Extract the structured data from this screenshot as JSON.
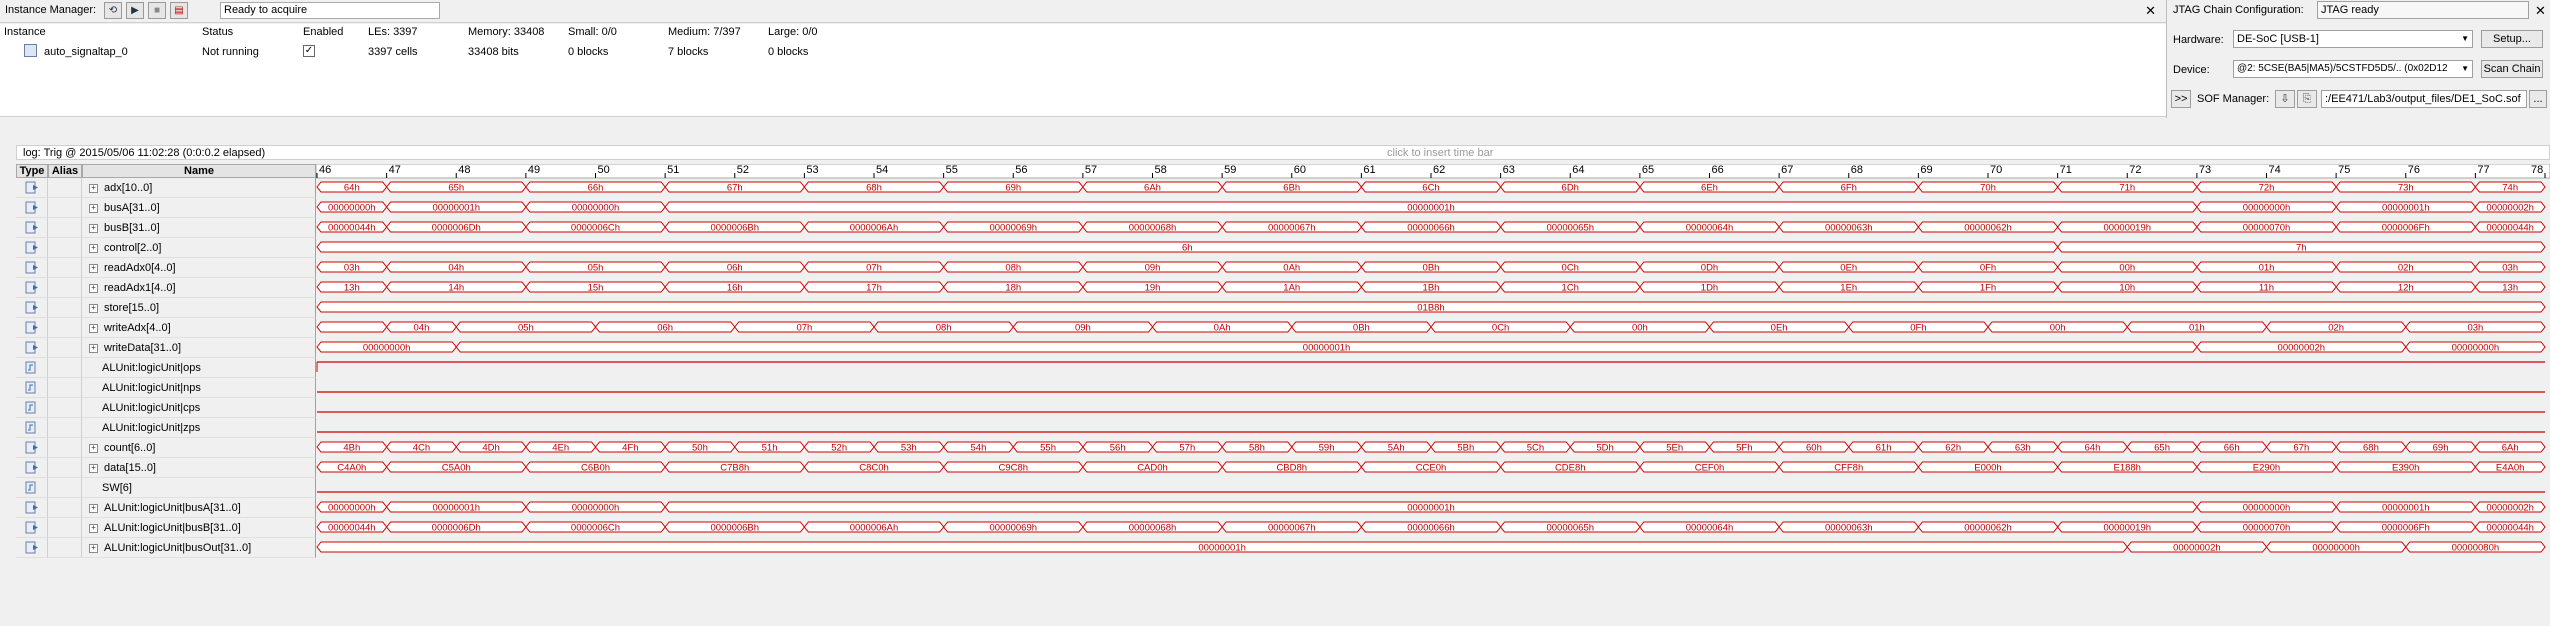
{
  "instance_manager": {
    "label": "Instance Manager:",
    "status": "Ready to acquire",
    "close": "✕",
    "headers": {
      "instance": "Instance",
      "status": "Status",
      "enabled": "Enabled",
      "les": "LEs: 3397",
      "memory": "Memory: 33408",
      "small": "Small: 0/0",
      "medium": "Medium: 7/397",
      "large": "Large: 0/0"
    },
    "row": {
      "instance": "auto_signaltap_0",
      "status": "Not running",
      "enabled": "✓",
      "les": "3397 cells",
      "memory": "33408 bits",
      "small": "0 blocks",
      "medium": "7 blocks",
      "large": "0 blocks"
    }
  },
  "jtag": {
    "title": "JTAG Chain Configuration:",
    "status": "JTAG ready",
    "close": "✕",
    "hardware_label": "Hardware:",
    "hardware_value": "DE-SoC [USB-1]",
    "setup_button": "Setup...",
    "device_label": "Device:",
    "device_value": "@2: 5CSE(BA5|MA5)/5CSTFD5D5/.. (0x02D12",
    "scan_button": "Scan Chain",
    "expand_button": ">>",
    "sof_label": "SOF Manager:",
    "sof_path": ":/EE471/Lab3/output_files/DE1_SoC.sof",
    "browse_button": "..."
  },
  "log": {
    "text": "log: Trig @ 2015/05/06 11:02:28 (0:0:0.2 elapsed)",
    "insert_hint": "click to insert time bar"
  },
  "columns": {
    "type": "Type",
    "alias": "Alias",
    "name": "Name"
  },
  "timeline": {
    "start": 46,
    "end": 78
  },
  "colors": {
    "wave": "#d00000",
    "grid_border": "#a0a0a0"
  },
  "signals": [
    {
      "name": "adx[10..0]",
      "expand": true,
      "icon": "bus-icon",
      "segments": [
        [
          46,
          47,
          "64h"
        ],
        [
          47,
          49,
          "65h"
        ],
        [
          49,
          51,
          "66h"
        ],
        [
          51,
          53,
          "67h"
        ],
        [
          53,
          55,
          "68h"
        ],
        [
          55,
          57,
          "69h"
        ],
        [
          57,
          59,
          "6Ah"
        ],
        [
          59,
          61,
          "6Bh"
        ],
        [
          61,
          63,
          "6Ch"
        ],
        [
          63,
          65,
          "6Dh"
        ],
        [
          65,
          67,
          "6Eh"
        ],
        [
          67,
          69,
          "6Fh"
        ],
        [
          69,
          71,
          "70h"
        ],
        [
          71,
          73,
          "71h"
        ],
        [
          73,
          75,
          "72h"
        ],
        [
          75,
          77,
          "73h"
        ],
        [
          77,
          78,
          "74h"
        ]
      ]
    },
    {
      "name": "busA[31..0]",
      "expand": true,
      "icon": "bus-icon",
      "segments": [
        [
          46,
          47,
          "00000000h"
        ],
        [
          47,
          49,
          "00000001h"
        ],
        [
          49,
          51,
          "00000000h"
        ],
        [
          51,
          73,
          "00000001h"
        ],
        [
          73,
          75,
          "00000000h"
        ],
        [
          75,
          77,
          "00000001h"
        ],
        [
          77,
          78,
          "00000002h"
        ]
      ]
    },
    {
      "name": "busB[31..0]",
      "expand": true,
      "icon": "bus-icon",
      "segments": [
        [
          46,
          47,
          "00000044h"
        ],
        [
          47,
          49,
          "0000006Dh"
        ],
        [
          49,
          51,
          "0000006Ch"
        ],
        [
          51,
          53,
          "0000006Bh"
        ],
        [
          53,
          55,
          "0000006Ah"
        ],
        [
          55,
          57,
          "00000069h"
        ],
        [
          57,
          59,
          "00000068h"
        ],
        [
          59,
          61,
          "00000067h"
        ],
        [
          61,
          63,
          "00000066h"
        ],
        [
          63,
          65,
          "00000065h"
        ],
        [
          65,
          67,
          "00000064h"
        ],
        [
          67,
          69,
          "00000063h"
        ],
        [
          69,
          71,
          "00000062h"
        ],
        [
          71,
          73,
          "00000019h"
        ],
        [
          73,
          75,
          "00000070h"
        ],
        [
          75,
          77,
          "0000006Fh"
        ],
        [
          77,
          78,
          "00000044h"
        ]
      ]
    },
    {
      "name": "control[2..0]",
      "expand": true,
      "icon": "bus-icon",
      "segments": [
        [
          46,
          71,
          "6h"
        ],
        [
          71,
          78,
          "7h"
        ]
      ]
    },
    {
      "name": "readAdx0[4..0]",
      "expand": true,
      "icon": "bus-icon",
      "segments": [
        [
          46,
          47,
          "03h"
        ],
        [
          47,
          49,
          "04h"
        ],
        [
          49,
          51,
          "05h"
        ],
        [
          51,
          53,
          "06h"
        ],
        [
          53,
          55,
          "07h"
        ],
        [
          55,
          57,
          "08h"
        ],
        [
          57,
          59,
          "09h"
        ],
        [
          59,
          61,
          "0Ah"
        ],
        [
          61,
          63,
          "0Bh"
        ],
        [
          63,
          65,
          "0Ch"
        ],
        [
          65,
          67,
          "0Dh"
        ],
        [
          67,
          69,
          "0Eh"
        ],
        [
          69,
          71,
          "0Fh"
        ],
        [
          71,
          73,
          "00h"
        ],
        [
          73,
          75,
          "01h"
        ],
        [
          75,
          77,
          "02h"
        ],
        [
          77,
          78,
          "03h"
        ]
      ]
    },
    {
      "name": "readAdx1[4..0]",
      "expand": true,
      "icon": "bus-icon",
      "segments": [
        [
          46,
          47,
          "13h"
        ],
        [
          47,
          49,
          "14h"
        ],
        [
          49,
          51,
          "15h"
        ],
        [
          51,
          53,
          "16h"
        ],
        [
          53,
          55,
          "17h"
        ],
        [
          55,
          57,
          "18h"
        ],
        [
          57,
          59,
          "19h"
        ],
        [
          59,
          61,
          "1Ah"
        ],
        [
          61,
          63,
          "1Bh"
        ],
        [
          63,
          65,
          "1Ch"
        ],
        [
          65,
          67,
          "1Dh"
        ],
        [
          67,
          69,
          "1Eh"
        ],
        [
          69,
          71,
          "1Fh"
        ],
        [
          71,
          73,
          "10h"
        ],
        [
          73,
          75,
          "11h"
        ],
        [
          75,
          77,
          "12h"
        ],
        [
          77,
          78,
          "13h"
        ]
      ]
    },
    {
      "name": "store[15..0]",
      "expand": true,
      "icon": "bus-icon",
      "segments": [
        [
          46,
          78,
          "01B8h"
        ]
      ]
    },
    {
      "name": "writeAdx[4..0]",
      "expand": true,
      "icon": "bus-icon",
      "segments": [
        [
          46,
          47,
          ""
        ],
        [
          47,
          48,
          "04h"
        ],
        [
          48,
          50,
          "05h"
        ],
        [
          50,
          52,
          "06h"
        ],
        [
          52,
          54,
          "07h"
        ],
        [
          54,
          56,
          "08h"
        ],
        [
          56,
          58,
          "09h"
        ],
        [
          58,
          60,
          "0Ah"
        ],
        [
          60,
          62,
          "0Bh"
        ],
        [
          62,
          64,
          "0Ch"
        ],
        [
          64,
          66,
          "00h"
        ],
        [
          66,
          68,
          "0Eh"
        ],
        [
          68,
          70,
          "0Fh"
        ],
        [
          70,
          72,
          "00h"
        ],
        [
          72,
          74,
          "01h"
        ],
        [
          74,
          76,
          "02h"
        ],
        [
          76,
          78,
          "03h"
        ]
      ]
    },
    {
      "name": "writeData[31..0]",
      "expand": true,
      "icon": "bus-icon",
      "segments": [
        [
          46,
          48,
          "00000000h"
        ],
        [
          48,
          73,
          "00000001h"
        ],
        [
          73,
          76,
          "00000002h"
        ],
        [
          76,
          78,
          "00000000h"
        ]
      ]
    },
    {
      "name": "ALUnit:logicUnit|ops",
      "expand": false,
      "icon": "bit-icon",
      "level": "high",
      "segments": []
    },
    {
      "name": "ALUnit:logicUnit|nps",
      "expand": false,
      "icon": "bit-icon",
      "level": "low",
      "segments": []
    },
    {
      "name": "ALUnit:logicUnit|cps",
      "expand": false,
      "icon": "bit-icon",
      "level": "low",
      "segments": []
    },
    {
      "name": "ALUnit:logicUnit|zps",
      "expand": false,
      "icon": "bit-icon",
      "level": "low",
      "segments": []
    },
    {
      "name": "count[6..0]",
      "expand": true,
      "icon": "bus-icon",
      "segments": [
        [
          46,
          47,
          "4Bh"
        ],
        [
          47,
          48,
          "4Ch"
        ],
        [
          48,
          49,
          "4Dh"
        ],
        [
          49,
          50,
          "4Eh"
        ],
        [
          50,
          51,
          "4Fh"
        ],
        [
          51,
          52,
          "50h"
        ],
        [
          52,
          53,
          "51h"
        ],
        [
          53,
          54,
          "52h"
        ],
        [
          54,
          55,
          "53h"
        ],
        [
          55,
          56,
          "54h"
        ],
        [
          56,
          57,
          "55h"
        ],
        [
          57,
          58,
          "56h"
        ],
        [
          58,
          59,
          "57h"
        ],
        [
          59,
          60,
          "58h"
        ],
        [
          60,
          61,
          "59h"
        ],
        [
          61,
          62,
          "5Ah"
        ],
        [
          62,
          63,
          "5Bh"
        ],
        [
          63,
          64,
          "5Ch"
        ],
        [
          64,
          65,
          "5Dh"
        ],
        [
          65,
          66,
          "5Eh"
        ],
        [
          66,
          67,
          "5Fh"
        ],
        [
          67,
          68,
          "60h"
        ],
        [
          68,
          69,
          "61h"
        ],
        [
          69,
          70,
          "62h"
        ],
        [
          70,
          71,
          "63h"
        ],
        [
          71,
          72,
          "64h"
        ],
        [
          72,
          73,
          "65h"
        ],
        [
          73,
          74,
          "66h"
        ],
        [
          74,
          75,
          "67h"
        ],
        [
          75,
          76,
          "68h"
        ],
        [
          76,
          77,
          "69h"
        ],
        [
          77,
          78,
          "6Ah"
        ]
      ]
    },
    {
      "name": "data[15..0]",
      "expand": true,
      "icon": "bus-icon",
      "segments": [
        [
          46,
          47,
          "C4A0h"
        ],
        [
          47,
          49,
          "C5A0h"
        ],
        [
          49,
          51,
          "C6B0h"
        ],
        [
          51,
          53,
          "C7B8h"
        ],
        [
          53,
          55,
          "C8C0h"
        ],
        [
          55,
          57,
          "C9C8h"
        ],
        [
          57,
          59,
          "CAD0h"
        ],
        [
          59,
          61,
          "CBD8h"
        ],
        [
          61,
          63,
          "CCE0h"
        ],
        [
          63,
          65,
          "CDE8h"
        ],
        [
          65,
          67,
          "CEF0h"
        ],
        [
          67,
          69,
          "CFF8h"
        ],
        [
          69,
          71,
          "E000h"
        ],
        [
          71,
          73,
          "E188h"
        ],
        [
          73,
          75,
          "E290h"
        ],
        [
          75,
          77,
          "E390h"
        ],
        [
          77,
          78,
          "E4A0h"
        ]
      ]
    },
    {
      "name": "SW[6]",
      "expand": false,
      "icon": "bit-icon",
      "level": "low",
      "segments": []
    },
    {
      "name": "ALUnit:logicUnit|busA[31..0]",
      "expand": true,
      "icon": "bus-icon",
      "segments": [
        [
          46,
          47,
          "00000000h"
        ],
        [
          47,
          49,
          "00000001h"
        ],
        [
          49,
          51,
          "00000000h"
        ],
        [
          51,
          73,
          "00000001h"
        ],
        [
          73,
          75,
          "00000000h"
        ],
        [
          75,
          77,
          "00000001h"
        ],
        [
          77,
          78,
          "00000002h"
        ]
      ]
    },
    {
      "name": "ALUnit:logicUnit|busB[31..0]",
      "expand": true,
      "icon": "bus-icon",
      "segments": [
        [
          46,
          47,
          "00000044h"
        ],
        [
          47,
          49,
          "0000006Dh"
        ],
        [
          49,
          51,
          "0000006Ch"
        ],
        [
          51,
          53,
          "0000006Bh"
        ],
        [
          53,
          55,
          "0000006Ah"
        ],
        [
          55,
          57,
          "00000069h"
        ],
        [
          57,
          59,
          "00000068h"
        ],
        [
          59,
          61,
          "00000067h"
        ],
        [
          61,
          63,
          "00000066h"
        ],
        [
          63,
          65,
          "00000065h"
        ],
        [
          65,
          67,
          "00000064h"
        ],
        [
          67,
          69,
          "00000063h"
        ],
        [
          69,
          71,
          "00000062h"
        ],
        [
          71,
          73,
          "00000019h"
        ],
        [
          73,
          75,
          "00000070h"
        ],
        [
          75,
          77,
          "0000006Fh"
        ],
        [
          77,
          78,
          "00000044h"
        ]
      ]
    },
    {
      "name": "ALUnit:logicUnit|busOut[31..0]",
      "expand": true,
      "icon": "bus-icon",
      "segments": [
        [
          46,
          72,
          "00000001h"
        ],
        [
          72,
          74,
          "00000002h"
        ],
        [
          74,
          76,
          "00000000h"
        ],
        [
          76,
          78,
          "00000080h"
        ]
      ]
    }
  ]
}
